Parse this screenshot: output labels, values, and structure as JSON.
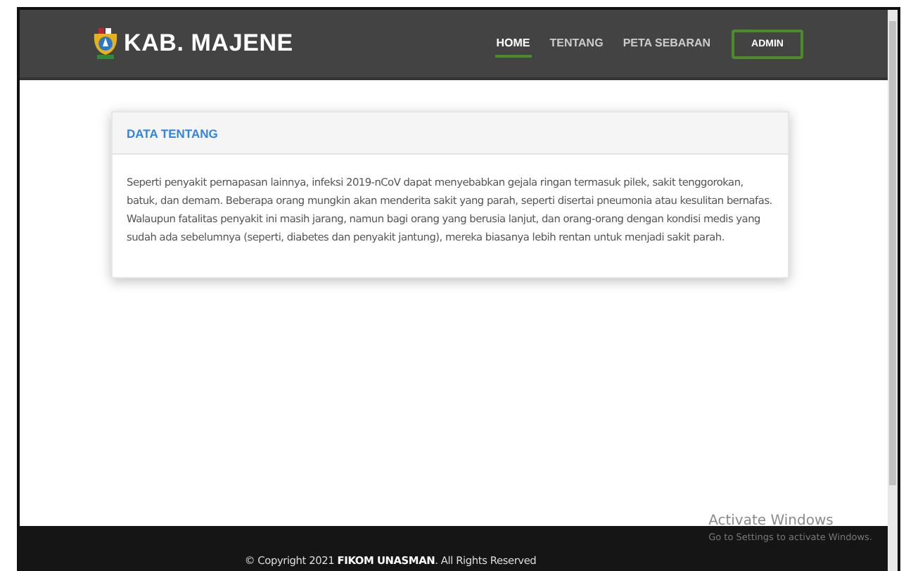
{
  "brand": {
    "title": "KAB. MAJENE"
  },
  "nav": [
    {
      "label": "HOME",
      "selected": true,
      "kind": "link"
    },
    {
      "label": "TENTANG",
      "selected": false,
      "kind": "link"
    },
    {
      "label": "PETA SEBARAN",
      "selected": false,
      "kind": "link"
    },
    {
      "label": "ADMIN",
      "selected": false,
      "kind": "button"
    }
  ],
  "card": {
    "title": "DATA TENTANG",
    "body": "Seperti penyakit pernapasan lainnya, infeksi 2019-nCoV dapat menyebabkan gejala ringan termasuk pilek, sakit tenggorokan, batuk, dan demam. Beberapa orang mungkin akan menderita sakit yang parah, seperti disertai pneumonia atau kesulitan bernafas. Walaupun fatalitas penyakit ini masih jarang, namun bagi orang yang berusia lanjut, dan orang-orang dengan kondisi medis yang sudah ada sebelumnya (seperti, diabetes dan penyakit jantung), mereka biasanya lebih rentan untuk menjadi sakit parah."
  },
  "footer": {
    "text": "© Copyright 2021 **FIKOM UNASMAN**. All Rights Reserved"
  },
  "activation_notice": {
    "title": "Activate Windows",
    "subtitle": "Go to Settings to activate Windows."
  }
}
